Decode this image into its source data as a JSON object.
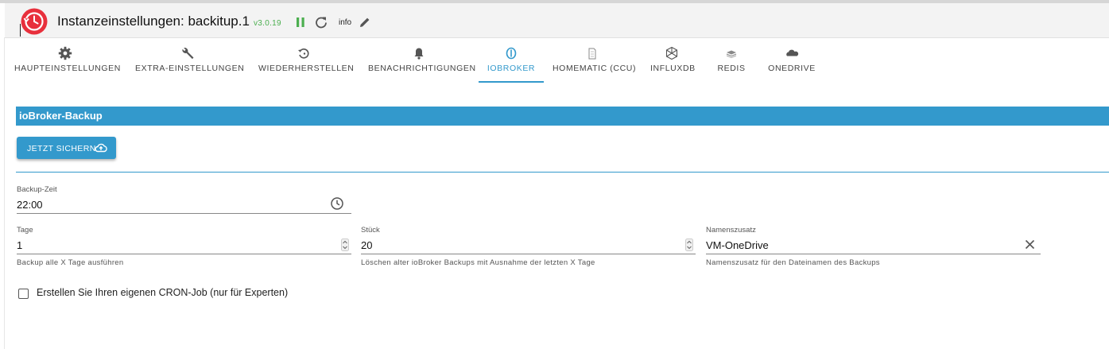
{
  "header": {
    "title": "Instanzeinstellungen: backitup.1",
    "version": "v3.0.19",
    "info_label": "info",
    "status_color": "#4caf50"
  },
  "tabs": [
    {
      "label": "HAUPTEINSTELLUNGEN",
      "icon": "gear-icon"
    },
    {
      "label": "EXTRA-EINSTELLUNGEN",
      "icon": "wrench-icon"
    },
    {
      "label": "WIEDERHERSTELLEN",
      "icon": "restore-icon"
    },
    {
      "label": "BENACHRICHTIGUNGEN",
      "icon": "bell-icon"
    },
    {
      "label": "IOBROKER",
      "icon": "iobroker-icon",
      "active": true
    },
    {
      "label": "HOMEMATIC (CCU)",
      "icon": "homematic-icon"
    },
    {
      "label": "INFLUXDB",
      "icon": "influxdb-icon"
    },
    {
      "label": "REDIS",
      "icon": "redis-icon"
    },
    {
      "label": "ONEDRIVE",
      "icon": "onedrive-icon"
    }
  ],
  "section": {
    "title": "ioBroker-Backup",
    "accent_color": "#3399cc"
  },
  "backup_button": {
    "label": "JETZT SICHERN",
    "icon": "cloud-upload-icon"
  },
  "fields": {
    "backup_time": {
      "label": "Backup-Zeit",
      "value": "22:00",
      "icon": "clock-icon"
    },
    "days": {
      "label": "Tage",
      "value": "1",
      "helper": "Backup alle X Tage ausführen"
    },
    "count": {
      "label": "Stück",
      "value": "20",
      "helper": "Löschen alter ioBroker Backups mit Ausnahme der letzten X Tage"
    },
    "name_suffix": {
      "label": "Namenszusatz",
      "value": "VM-OneDrive",
      "helper": "Namenszusatz für den Dateinamen des Backups"
    }
  },
  "cron": {
    "label": "Erstellen Sie Ihren eigenen CRON-Job (nur für Experten)",
    "checked": false
  }
}
